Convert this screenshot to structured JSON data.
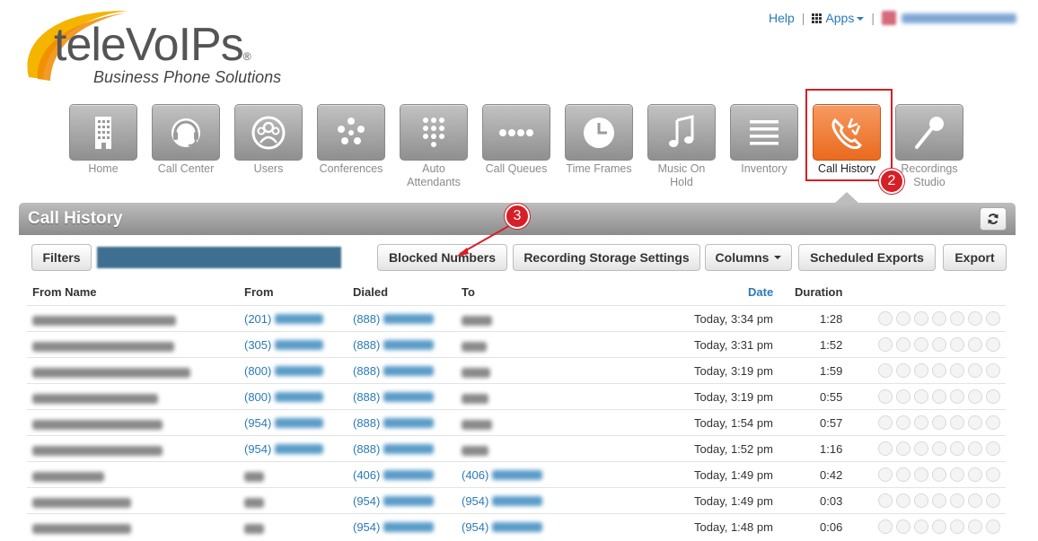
{
  "brand": {
    "name": "teleVoIPs",
    "tagline": "Business Phone Solutions"
  },
  "top_links": {
    "help": "Help",
    "apps": "Apps"
  },
  "nav": [
    {
      "label": "Home",
      "icon": "building-icon"
    },
    {
      "label": "Call Center",
      "icon": "headset-icon"
    },
    {
      "label": "Users",
      "icon": "users-icon"
    },
    {
      "label": "Conferences",
      "icon": "conference-icon"
    },
    {
      "label": "Auto Attendants",
      "icon": "keypad-icon"
    },
    {
      "label": "Call Queues",
      "icon": "queue-icon"
    },
    {
      "label": "Time Frames",
      "icon": "clock-icon"
    },
    {
      "label": "Music On Hold",
      "icon": "music-icon"
    },
    {
      "label": "Inventory",
      "icon": "list-icon"
    },
    {
      "label": "Call History",
      "icon": "call-history-icon",
      "active": true
    },
    {
      "label": "Recordings Studio",
      "icon": "microphone-icon"
    }
  ],
  "annotations": {
    "step2": "2",
    "step3": "3"
  },
  "panel": {
    "title": "Call History"
  },
  "toolbar": {
    "filters": "Filters",
    "blocked_numbers": "Blocked Numbers",
    "recording_storage": "Recording Storage Settings",
    "columns": "Columns",
    "scheduled_exports": "Scheduled Exports",
    "export": "Export"
  },
  "table": {
    "headers": {
      "from_name": "From Name",
      "from": "From",
      "dialed": "Dialed",
      "to": "To",
      "date": "Date",
      "duration": "Duration"
    },
    "rows": [
      {
        "from_area": "(201)",
        "dialed_area": "(888)",
        "to_area": "",
        "date": "Today, 3:34 pm",
        "duration": "1:28"
      },
      {
        "from_area": "(305)",
        "dialed_area": "(888)",
        "to_area": "",
        "date": "Today, 3:31 pm",
        "duration": "1:52"
      },
      {
        "from_area": "(800)",
        "dialed_area": "(888)",
        "to_area": "",
        "date": "Today, 3:19 pm",
        "duration": "1:59"
      },
      {
        "from_area": "(800)",
        "dialed_area": "(888)",
        "to_area": "",
        "date": "Today, 3:19 pm",
        "duration": "0:55"
      },
      {
        "from_area": "(954)",
        "dialed_area": "(888)",
        "to_area": "",
        "date": "Today, 1:54 pm",
        "duration": "0:57"
      },
      {
        "from_area": "(954)",
        "dialed_area": "(888)",
        "to_area": "",
        "date": "Today, 1:52 pm",
        "duration": "1:16"
      },
      {
        "from_area": "",
        "dialed_area": "(406)",
        "to_area": "(406)",
        "date": "Today, 1:49 pm",
        "duration": "0:42"
      },
      {
        "from_area": "",
        "dialed_area": "(954)",
        "to_area": "(954)",
        "date": "Today, 1:49 pm",
        "duration": "0:03"
      },
      {
        "from_area": "",
        "dialed_area": "(954)",
        "to_area": "(954)",
        "date": "Today, 1:48 pm",
        "duration": "0:06"
      }
    ]
  },
  "colors": {
    "accent": "#2a7ab8",
    "active_tile": "#ea6a1e",
    "annotation": "#d61f26"
  }
}
